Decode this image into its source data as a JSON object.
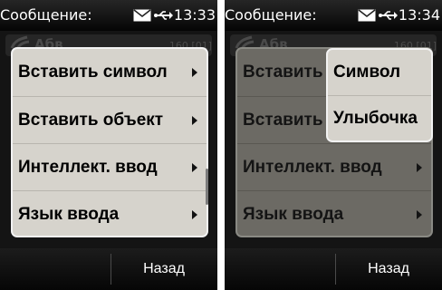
{
  "status_bar": {
    "title": "Сообщение:",
    "time_left": "13:33",
    "time_right": "13:34",
    "mail_icon": "mail-icon",
    "usb_icon": "usb-icon"
  },
  "message": {
    "recipient": "Абв",
    "counter": "160 [01]"
  },
  "menu": {
    "items": [
      {
        "label": "Вставить символ",
        "icon": "chevron-right-icon"
      },
      {
        "label": "Вставить объект",
        "icon": "chevron-right-icon"
      },
      {
        "label": "Интеллект. ввод",
        "icon": "chevron-right-icon"
      },
      {
        "label": "Язык ввода",
        "icon": "chevron-right-icon"
      }
    ]
  },
  "submenu": {
    "items": [
      {
        "label": "Символ"
      },
      {
        "label": "Улыбочка"
      }
    ]
  },
  "softkeys": {
    "back_label": "Назад"
  },
  "colors": {
    "menu_bg": "#d6d3cc",
    "menu_border": "#f2f2f2",
    "screen_bg": "#101010",
    "dimmed_menu_bg": "#6c6a64"
  }
}
